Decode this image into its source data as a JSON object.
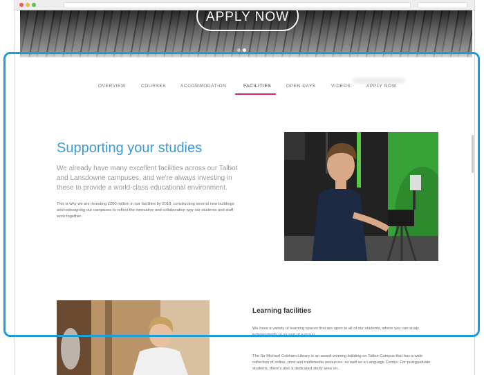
{
  "hero": {
    "button_label": "APPLY NOW",
    "slide_count": 2,
    "active_slide": 2
  },
  "nav": {
    "items": [
      {
        "label": "OVERVIEW"
      },
      {
        "label": "COURSES"
      },
      {
        "label": "ACCOMMODATION"
      },
      {
        "label": "FACILITIES"
      },
      {
        "label": "OPEN DAYS"
      },
      {
        "label": "VIDEOS"
      },
      {
        "label": "APPLY NOW"
      }
    ],
    "active": "FACILITIES",
    "active_color": "#d6245c"
  },
  "main": {
    "heading": "Supporting your studies",
    "heading_color": "#3a9bd4",
    "lead": "We already have many excellent facilities across our Talbot and Lansdowne campuses, and we're always investing in these to provide a world-class educational environment.",
    "body": "This is why we are investing £200 million in our facilities by 2018, constructing several new buildings and redesigning our campuses to reflect the innovative and collaborative way our students and staff work together."
  },
  "learning": {
    "title": "Learning facilities",
    "p1": "We have a variety of learning spaces that are open to all of our students, where you can study independently or as part of a group.",
    "p2": "The Sir Michael Cobham Library is an award-winning building on Talbot Campus that has a wide collection of online, print and multimedia resources, as well as a Language Centre. For postgraduate students, there's also a dedicated study area on..."
  },
  "highlight_color": "#1a9fd8"
}
